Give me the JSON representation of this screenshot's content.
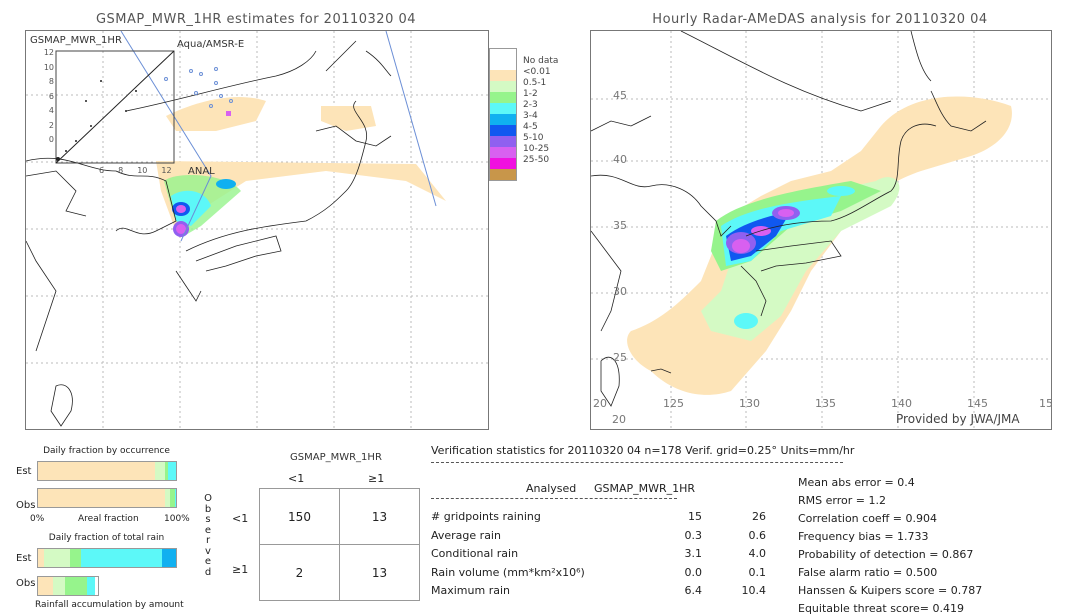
{
  "left_map": {
    "title": "GSMAP_MWR_1HR estimates for 20110320 04",
    "inset_label": "GSMAP_MWR_1HR",
    "sensor_label": "Aqua/AMSR-E",
    "anal_label": "ANAL",
    "inset_y_ticks": [
      "12",
      "10",
      "8",
      "6",
      "4",
      "2",
      "0"
    ],
    "inset_x_ticks": [
      "6",
      "8",
      "10",
      "12"
    ]
  },
  "right_map": {
    "title": "Hourly Radar-AMeDAS analysis for 20110320 04",
    "lat_ticks": [
      "45",
      "40",
      "35",
      "30",
      "25",
      "20"
    ],
    "lon_ticks": [
      "125",
      "130",
      "135",
      "140",
      "145",
      "15"
    ],
    "corner_label": "20",
    "credit": "Provided by JWA/JMA"
  },
  "legend": {
    "items": [
      {
        "label": "No data",
        "color": "#ffffff"
      },
      {
        "label": "<0.01",
        "color": "#fde4b8"
      },
      {
        "label": "0.5-1",
        "color": "#d4fac4"
      },
      {
        "label": "1-2",
        "color": "#96f48c"
      },
      {
        "label": "2-3",
        "color": "#5cf8f8"
      },
      {
        "label": "3-4",
        "color": "#10b0f0"
      },
      {
        "label": "4-5",
        "color": "#1058f0"
      },
      {
        "label": "5-10",
        "color": "#9060f0"
      },
      {
        "label": "10-25",
        "color": "#d860f0"
      },
      {
        "label": "25-50",
        "color": "#f010e0"
      },
      {
        "label": "",
        "color": "#c8964a"
      }
    ]
  },
  "occurrence": {
    "title": "Daily fraction by occurrence",
    "est_label": "Est",
    "obs_label": "Obs",
    "axis_left": "0%",
    "axis_mid": "Areal fraction",
    "axis_right": "100%",
    "est_fractions": [
      0.85,
      0.07,
      0.02,
      0.06
    ],
    "obs_fractions": [
      0.92,
      0.04,
      0.03,
      0.01
    ]
  },
  "total_rain": {
    "title": "Daily fraction of total rain",
    "est_label": "Est",
    "obs_label": "Obs",
    "caption": "Rainfall accumulation by amount",
    "est_fractions": [
      0.04,
      0.19,
      0.08,
      0.59,
      0.1
    ],
    "obs_fractions": [
      0.25,
      0.2,
      0.37,
      0.13
    ]
  },
  "contingency": {
    "header": "GSMAP_MWR_1HR",
    "col_labels": [
      "<1",
      "≥1"
    ],
    "row_axis_label": "Observed",
    "row_labels": [
      "<1",
      "≥1"
    ],
    "cells": [
      [
        "150",
        "13"
      ],
      [
        "2",
        "13"
      ]
    ]
  },
  "verification": {
    "header": "Verification statistics for 20110320 04   n=178   Verif. grid=0.25°   Units=mm/hr",
    "col_analysed": "Analysed",
    "col_gsmap": "GSMAP_MWR_1HR",
    "rows": [
      {
        "label": "# gridpoints raining",
        "analysed": "15",
        "gsmap": "26"
      },
      {
        "label": "Average rain",
        "analysed": "0.3",
        "gsmap": "0.6"
      },
      {
        "label": "Conditional rain",
        "analysed": "3.1",
        "gsmap": "4.0"
      },
      {
        "label": "Rain volume (mm*km²x10⁶)",
        "analysed": "0.0",
        "gsmap": "0.1"
      },
      {
        "label": "Maximum rain",
        "analysed": "6.4",
        "gsmap": "10.4"
      }
    ],
    "scores": [
      "Mean abs error = 0.4",
      "RMS error = 1.2",
      "Correlation coeff = 0.904",
      "Frequency bias = 1.733",
      "Probability of detection = 0.867",
      "False alarm ratio = 0.500",
      "Hanssen & Kuipers score = 0.787",
      "Equitable threat score= 0.419"
    ]
  }
}
